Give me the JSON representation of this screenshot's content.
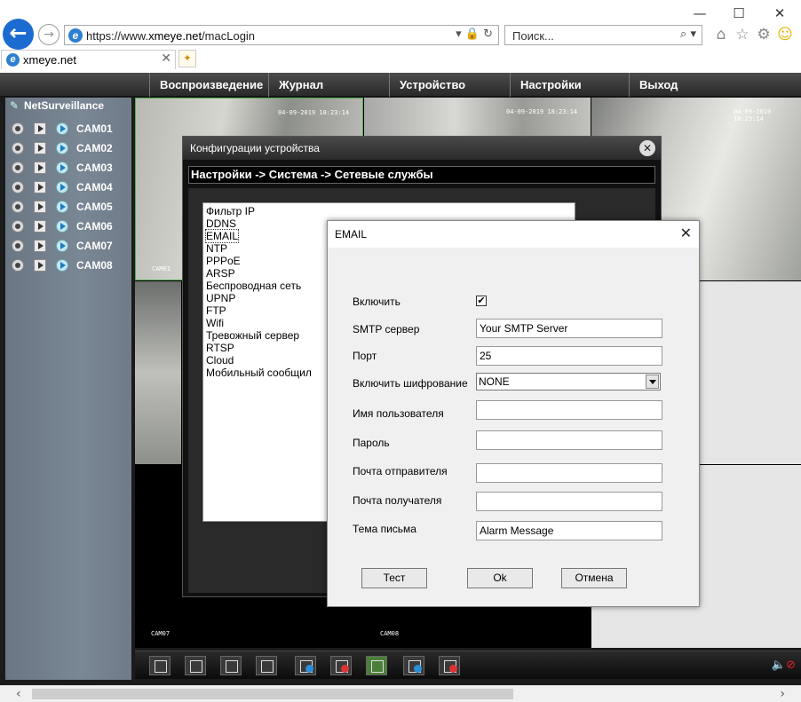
{
  "browser": {
    "url_prefix": "https://www.",
    "url_host": "xmeye.net",
    "url_path": "/macLogin",
    "search_placeholder": "Поиск...",
    "tab_title": "xmeye.net",
    "window_controls": [
      "—",
      "☐",
      "✕"
    ]
  },
  "nav": {
    "items": [
      "Воспроизведение",
      "Журнал",
      "Устройство",
      "Настройки",
      "Выход"
    ]
  },
  "sidebar": {
    "title": "NetSurveillance",
    "cameras": [
      "CAM01",
      "CAM02",
      "CAM03",
      "CAM04",
      "CAM05",
      "CAM06",
      "CAM07",
      "CAM08"
    ]
  },
  "grid": {
    "timestamps": [
      "04-09-2019 18:23:14",
      "04-09-2019 18:23:14",
      "04-09-2019 18:23:14"
    ],
    "labels": [
      "CAM01",
      "CAM07",
      "CAM08"
    ]
  },
  "config_dialog": {
    "title": "Конфигурации устройства",
    "breadcrumb": "Настройки -> Система -> Сетевые службы",
    "services": [
      "Фильтр IP",
      "DDNS",
      "EMAIL",
      "NTP",
      "PPPoE",
      "ARSP",
      "Беспроводная сеть",
      "UPNP",
      "FTP",
      "Wifi",
      "Тревожный сервер",
      "RTSP",
      "Cloud",
      "Мобильный сообщил"
    ],
    "selected_service": "EMAIL"
  },
  "email_dialog": {
    "title": "EMAIL",
    "fields": {
      "enable_label": "Включить",
      "enable_checked": "✔",
      "smtp_label": "SMTP сервер",
      "smtp_value": "Your SMTP Server",
      "port_label": "Порт",
      "port_value": "25",
      "encryption_label": "Включить шифрование",
      "encryption_value": "NONE",
      "user_label": "Имя пользователя",
      "user_value": "",
      "password_label": "Пароль",
      "password_value": "",
      "sender_label": "Почта отправителя",
      "sender_value": "",
      "recipient_label": "Почта получателя",
      "recipient_value": "",
      "subject_label": "Тема письма",
      "subject_value": "Alarm Message"
    },
    "buttons": {
      "test": "Тест",
      "ok": "Ok",
      "cancel": "Отмена"
    }
  }
}
